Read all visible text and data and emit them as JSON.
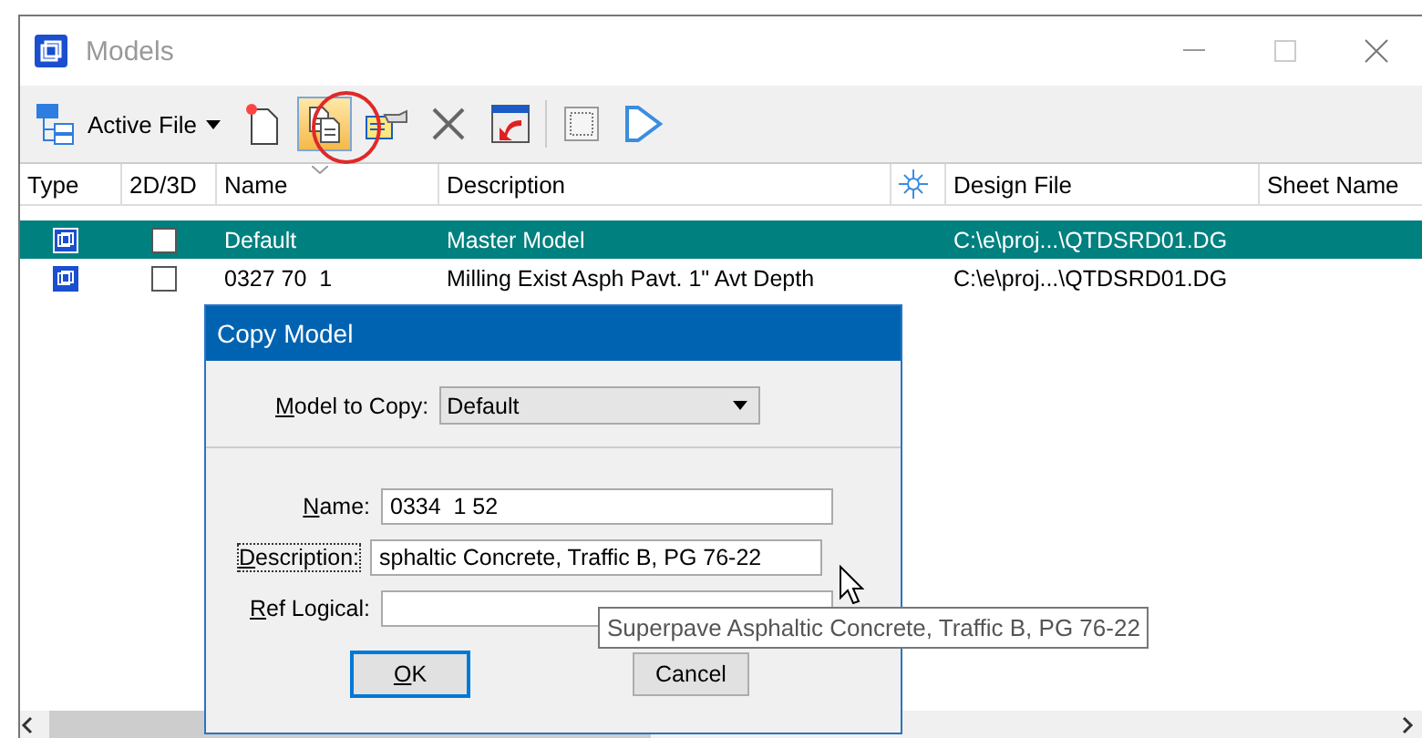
{
  "window": {
    "title": "Models"
  },
  "toolbar": {
    "source": "Active File",
    "buttons": [
      {
        "kind": "new",
        "active": false
      },
      {
        "kind": "copy",
        "active": true
      },
      {
        "kind": "properties",
        "active": false
      },
      {
        "kind": "delete",
        "active": false
      },
      {
        "kind": "import",
        "active": false
      },
      {
        "kind": "select",
        "active": false
      },
      {
        "kind": "filter",
        "active": false
      }
    ]
  },
  "table": {
    "columns": [
      "Type",
      "2D/3D",
      "Name",
      "Description",
      "",
      "Design File",
      "Sheet Name"
    ],
    "rows": [
      {
        "checked": false,
        "name": "Default",
        "description": "Master Model",
        "design_file": "C:\\e\\proj...\\QTDSRD01.DG",
        "selected": true
      },
      {
        "checked": false,
        "name": "0327 70  1",
        "description": "Milling Exist Asph Pavt. 1\" Avt Depth",
        "design_file": "C:\\e\\proj...\\QTDSRD01.DG",
        "selected": false
      }
    ]
  },
  "dialog": {
    "title": "Copy Model",
    "model_label": "Model to Copy:",
    "model_value": "Default",
    "name_label": "Name:",
    "name_value": "0334  1 52",
    "description_label": "Description:",
    "description_value": "sphaltic Concrete, Traffic B, PG 76-22",
    "ref_label": "Ref Logical:",
    "ok": "OK",
    "cancel": "Cancel"
  },
  "tooltip": "Superpave Asphaltic Concrete, Traffic B, PG 76-22"
}
